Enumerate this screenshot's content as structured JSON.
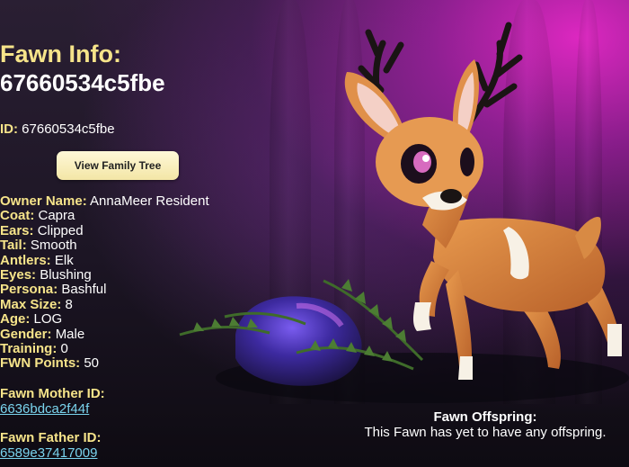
{
  "header": {
    "title_line1": "Fawn Info:",
    "title_line2": "67660534c5fbe"
  },
  "id": {
    "label": "ID:",
    "value": "67660534c5fbe"
  },
  "family_tree_button": "View Family Tree",
  "attributes": [
    {
      "label": "Owner Name:",
      "value": "AnnaMeer Resident"
    },
    {
      "label": "Coat:",
      "value": "Capra"
    },
    {
      "label": "Ears:",
      "value": "Clipped"
    },
    {
      "label": "Tail:",
      "value": "Smooth"
    },
    {
      "label": "Antlers:",
      "value": "Elk"
    },
    {
      "label": "Eyes:",
      "value": "Blushing"
    },
    {
      "label": "Persona:",
      "value": "Bashful"
    },
    {
      "label": "Max Size:",
      "value": "8"
    },
    {
      "label": "Age:",
      "value": "LOG"
    },
    {
      "label": "Gender:",
      "value": "Male"
    },
    {
      "label": "Training:",
      "value": "0"
    },
    {
      "label": "FWN Points:",
      "value": "50"
    }
  ],
  "mother": {
    "label": "Fawn Mother ID:",
    "id": "6636bdca2f44f"
  },
  "father": {
    "label": "Fawn Father ID:",
    "id": "6589e37417009"
  },
  "offspring": {
    "title": "Fawn Offspring:",
    "text": "This Fawn has yet to have any offspring."
  },
  "colors": {
    "accent_yellow": "#f6e48a",
    "link_blue": "#7ad4ee",
    "background_magenta": "#e628c8"
  }
}
